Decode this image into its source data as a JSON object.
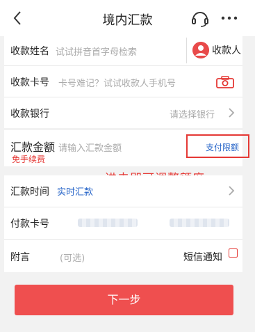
{
  "header": {
    "title": "境内汇款",
    "back_icon": "back-chevron-icon",
    "service_icon": "headset-icon",
    "more_icon": "more-dots-icon"
  },
  "form": {
    "payee_name": {
      "label": "收款姓名",
      "placeholder": "试试拼音首字母检索",
      "payee_button_label": "收款人"
    },
    "card_number": {
      "label": "收款卡号",
      "placeholder": "卡号难记？试试收款人手机号"
    },
    "bank": {
      "label": "收款银行",
      "placeholder": "请选择银行"
    },
    "amount": {
      "label": "汇款金额",
      "fee_badge": "免手续费",
      "placeholder": "请输入汇款金额",
      "limit_link": "支付限额"
    },
    "transfer_time": {
      "label": "汇款时间",
      "value": "实时汇款"
    },
    "payer_card": {
      "label": "付款卡号"
    },
    "note": {
      "label": "附言",
      "placeholder": "(可选)",
      "sms_label": "短信通知"
    }
  },
  "annotation": "进去即可调整额度",
  "next_button": "下一步",
  "colors": {
    "accent_red": "#e53935",
    "button_red": "#ef4f4f",
    "link_blue": "#2a67c9",
    "background": "#f2f2f2"
  }
}
